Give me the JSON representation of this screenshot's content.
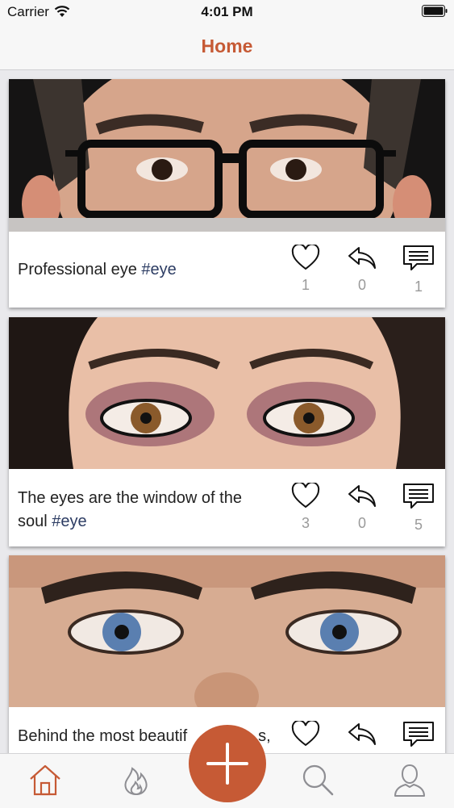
{
  "status_bar": {
    "carrier": "Carrier",
    "time": "4:01 PM"
  },
  "nav": {
    "title": "Home"
  },
  "posts": [
    {
      "caption": "Professional eye ",
      "hashtag": "#eye",
      "likes": "1",
      "shares": "0",
      "comments": "1"
    },
    {
      "caption": "The eyes are the window of the soul ",
      "hashtag": "#eye",
      "likes": "3",
      "shares": "0",
      "comments": "5"
    },
    {
      "caption": "Behind the most beautif",
      "caption_hidden_end": "s,",
      "hashtag": "",
      "likes": "",
      "shares": "",
      "comments": ""
    }
  ],
  "colors": {
    "accent": "#c65a35",
    "hashtag": "#2c3c63",
    "count": "#9a9a9a"
  },
  "tabs": [
    "home-icon",
    "flame-icon",
    "add-icon",
    "search-icon",
    "profile-icon"
  ]
}
